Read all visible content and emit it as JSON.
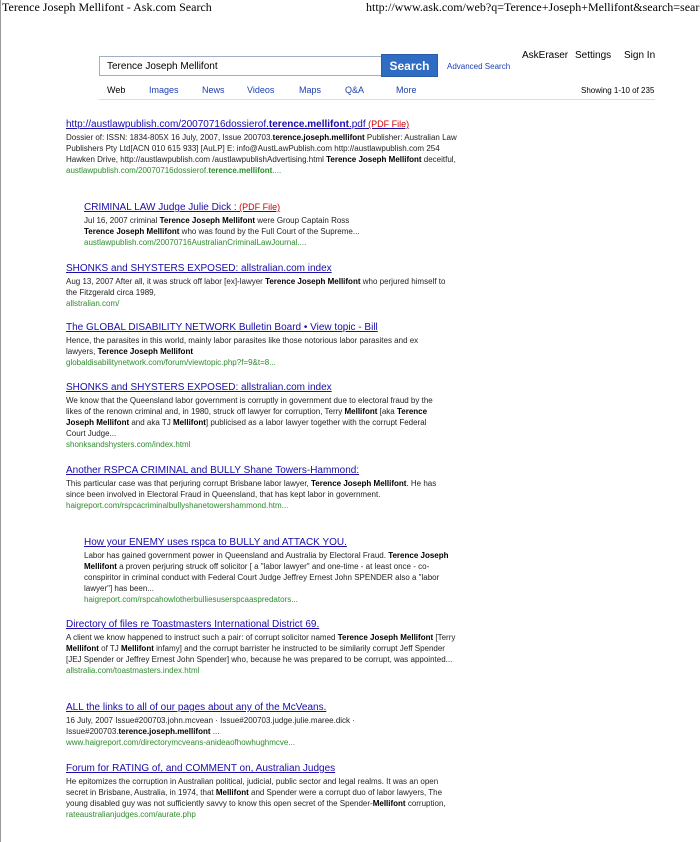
{
  "print_header": {
    "title": "Terence Joseph Mellifont - Ask.com Search",
    "url": "http://www.ask.com/web?q=Terence+Joseph+Mellifont&search=search..."
  },
  "top_links": {
    "askeraser": "AskEraser",
    "settings": "Settings",
    "signin": "Sign In"
  },
  "search": {
    "query": "Terence Joseph Mellifont",
    "button_label": "Search",
    "advanced_label": "Advanced Search"
  },
  "tabs": [
    "Web",
    "Images",
    "News",
    "Videos",
    "Maps",
    "Q&A",
    "More"
  ],
  "showing": "Showing 1-10 of 235",
  "results": [
    {
      "title_pre": "http://austlawpublish.com/20070716dossierof.",
      "title_bold": "terence.mellifont",
      "title_post": ".pdf",
      "badge": "(PDF File)",
      "snippet_html": "Dossier of: ISSN: 1834-805X 16 July, 2007, Issue 200703.<b>terence.joseph.mellifont</b> Publisher: Australian Law Publishers Pty Ltd[ACN 010 615 933] [AuLP] E: info@AustLawPublish.com http://austlawpublish.com 254 Hawken Drive, http://austlawpublish.com /austlawpublishAdvertising.html <b>Terence Joseph Mellifont</b> deceitful,",
      "url_html": "austlawpublish.com/20070716dossierof.<b>terence.mellifont</b>...."
    },
    {
      "title_pre": "CRIMINAL LAW Judge Julie Dick :",
      "title_bold": "",
      "title_post": "",
      "badge": "(PDF File)",
      "snippet_html": "Jul 16, 2007 criminal <b>Terence Joseph Mellifont</b> were Group Captain Ross <b>Terence Joseph Mellifont</b> who was found by the Full Court of the Supreme...",
      "url_html": "austlawpublish.com/20070716AustralianCriminalLawJournal...."
    },
    {
      "title_pre": "SHONKS and SHYSTERS EXPOSED: allstralian.com index",
      "title_bold": "",
      "title_post": "",
      "badge": "",
      "snippet_html": "Aug 13, 2007 After all, it was struck off labor [ex]-lawyer <b>Terence Joseph Mellifont</b> who perjured himself to the Fitzgerald circa 1989,",
      "url_html": "allstralian.com/"
    },
    {
      "title_pre": "The GLOBAL DISABILITY NETWORK Bulletin Board • View topic - Bill",
      "title_bold": "",
      "title_post": "",
      "badge": "",
      "snippet_html": "Hence, the parasites in this world, mainly labor parasites like those notorious labor parasites and ex lawyers, <b>Terence Joseph Mellifont</b>",
      "url_html": "globaldisabilitynetwork.com/forum/viewtopic.php?f=9&t=8..."
    },
    {
      "title_pre": "SHONKS and SHYSTERS EXPOSED: allstralian.com index",
      "title_bold": "",
      "title_post": "",
      "badge": "",
      "snippet_html": "We know that the Queensland labor government is corruptly in government due to electoral fraud by the likes of the renown criminal and, in 1980, struck off lawyer for corruption, Terry <b>Mellifont</b> [aka <b>Terence Joseph Mellifont</b> and aka TJ <b>Mellifont</b>] publicised as a labor lawyer together with the corrupt Federal Court Judge...",
      "url_html": "shonksandshysters.com/index.html"
    },
    {
      "title_pre": "Another RSPCA CRIMINAL and BULLY Shane Towers-Hammond:",
      "title_bold": "",
      "title_post": "",
      "badge": "",
      "snippet_html": "This particular case was that perjuring corrupt Brisbane labor lawyer, <b>Terence Joseph Mellifont</b>. He has since been involved in Electoral Fraud in Queensland, that has kept labor in government.",
      "url_html": "haigreport.com/rspcacriminalbullyshanetowershammond.htm..."
    },
    {
      "title_pre": "How your ENEMY uses rspca to BULLY and ATTACK YOU.",
      "title_bold": "",
      "title_post": "",
      "badge": "",
      "snippet_html": "Labor has gained government power in Queensland and Australia by Electoral Fraud. <b>Terence Joseph Mellifont</b> a proven perjuring struck off solicitor [ a \"labor lawyer\" and one-time - at least once - co-conspiritor in criminal conduct with Federal Court Judge Jeffrey Ernest John SPENDER also a \"labor lawyer\"] has been...",
      "url_html": "haigreport.com/rspcahowlotherbulliesuserspcaaspredators..."
    },
    {
      "title_pre": "Directory of files re Toastmasters International District 69.",
      "title_bold": "",
      "title_post": "",
      "badge": "",
      "snippet_html": "A client we know happened to instruct such a pair: of corrupt solicitor named <b>Terence Joseph Mellifont</b> [Terry <b>Mellifont</b> of TJ <b>Mellifont</b> infamy] and the corrupt barrister he instructed to be similarily corrupt Jeff Spender [JEJ Spender or Jeffrey Ernest John Spender] who, because he was prepared to be corrupt, was appointed...",
      "url_html": "allstralia.com/toastmasters.index.html"
    },
    {
      "title_pre": "ALL the links to all of our pages about any of the McVeans.",
      "title_bold": "",
      "title_post": "",
      "badge": "",
      "snippet_html": "16 July, 2007 Issue#200703.john.mcvean · Issue#200703.judge.julie.maree.dick · Issue#200703.<b>terence.joseph.mellifont</b> ...",
      "url_html": "www.haigreport.com/directorymcveans-anideaofhowhughmcve..."
    },
    {
      "title_pre": "Forum for RATING of, and COMMENT on, Australian Judges",
      "title_bold": "",
      "title_post": "",
      "badge": "",
      "snippet_html": "He epitomizes the corruption in Australian political, judicial, public sector and legal realms. It was an open secret in Brisbane, Australia, in 1974, that <b>Mellifont</b> and Spender were a corrupt duo of labor lawyers, The young disabled guy was not sufficiently savvy to know this open secret of the Spender-<b>Mellifont</b> corruption,",
      "url_html": "rateaustralianjudges.com/aurate.php"
    }
  ],
  "colors": {
    "link": "#1a0dab",
    "url_green": "#2e8b2e",
    "pdf_badge": "#cc0000",
    "search_button": "#2f6cc4"
  }
}
